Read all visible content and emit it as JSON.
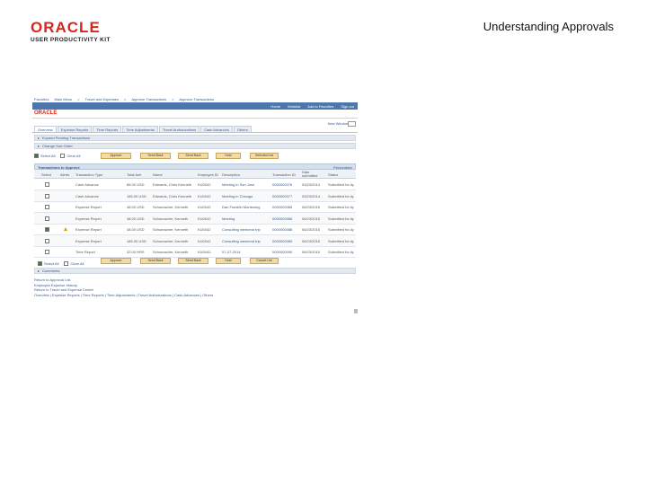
{
  "header": {
    "logo_name": "ORACLE",
    "logo_sub": "USER PRODUCTIVITY KIT",
    "title": "Understanding Approvals"
  },
  "app": {
    "topnav": [
      "Favorites",
      "Main Menu",
      ">",
      "Travel and Expenses",
      ">",
      "Approve Transactions",
      ">",
      "Approve Transactions"
    ],
    "util_links": [
      "Home",
      "Worklist",
      "Add to Favorites",
      "Sign out"
    ],
    "brand": "ORACLE",
    "new_window": "New Window",
    "tabs": [
      "Overview",
      "Expense Reports",
      "Time Reports",
      "Time Adjustments",
      "Travel Authorizations",
      "Cash Advances",
      "Others"
    ],
    "sections": {
      "expand_pending": "Expand Pending Transactions",
      "change_sort": "Change Sort Order",
      "comments": "Comments"
    },
    "actions": {
      "select_all": "Select All",
      "clear_all": "Clear All",
      "buttons": [
        "Approve",
        "Send Back",
        "Send Back",
        "Hold",
        "Selected List"
      ],
      "bottom_buttons": [
        "Approve",
        "Send Back",
        "Send Back",
        "Hold",
        "Cancel List"
      ]
    },
    "grid": {
      "title": "Transactions to Approve",
      "personalize": "Personalize",
      "columns": [
        "Select",
        "Alerts",
        "Transaction Type",
        "Total Amt",
        "Name",
        "Employee ID",
        "Description",
        "Transaction ID",
        "Date submitted",
        "Status"
      ],
      "rows": [
        {
          "type": "Cash Advance",
          "amount": "85.00 USD",
          "name": "Edwards, Chris Kenneth",
          "id": "KU0042",
          "desc": "Meeting in San Jose",
          "txn": "0000000076",
          "date": "03/23/2014",
          "status": "Submitted for Approval",
          "alert": false,
          "checked": false
        },
        {
          "type": "Cash Advance",
          "amount": "185.00 USD",
          "name": "Edwards, Chris Kenneth",
          "id": "KU0042",
          "desc": "Meeting in Chicago",
          "txn": "0000000077",
          "date": "03/23/2014",
          "status": "Submitted for Approval",
          "alert": false,
          "checked": false
        },
        {
          "type": "Expense Report",
          "amount": "48.00 USD",
          "name": "Schumacher, Kenneth",
          "id": "KU0042",
          "desc": "Dan Franklin Monitoring",
          "txn": "0000000085",
          "date": "06/23/2015",
          "status": "Submitted for Approval",
          "alert": false,
          "checked": false
        },
        {
          "type": "Expense Report",
          "amount": "48.00 USD",
          "name": "Schumacher, Kenneth",
          "id": "KU0042",
          "desc": "Meeting",
          "txn": "0000000086",
          "date": "06/23/2015",
          "status": "Submitted for Approval",
          "alert": false,
          "checked": false
        },
        {
          "type": "Expense Report",
          "amount": "48.00 USD",
          "name": "Schumacher, Kenneth",
          "id": "KU0042",
          "desc": "Consulting weekend trip",
          "txn": "0000000088",
          "date": "06/23/2015",
          "status": "Submitted for Approval",
          "alert": true,
          "checked": true
        },
        {
          "type": "Expense Report",
          "amount": "185.00 USD",
          "name": "Schumacher, Kenneth",
          "id": "KU0042",
          "desc": "Consulting weekend trip",
          "txn": "0000000089",
          "date": "06/23/2015",
          "status": "Submitted for Approval",
          "alert": false,
          "checked": false
        },
        {
          "type": "Time Report",
          "amount": "32.00 HRS",
          "name": "Schumacher, Kenneth",
          "id": "KU0042",
          "desc": "07-27-2014",
          "txn": "0000000090",
          "date": "06/23/2015",
          "status": "Submitted for Approval",
          "alert": false,
          "checked": false
        }
      ]
    },
    "bottom_links": [
      "Return to Approval List",
      "Employee Expense History",
      "Return to Travel and Expense Center",
      "Overview | Expense Reports | Time Reports | Time Adjustments | Travel Authorizations | Cash Advances | Others"
    ]
  }
}
